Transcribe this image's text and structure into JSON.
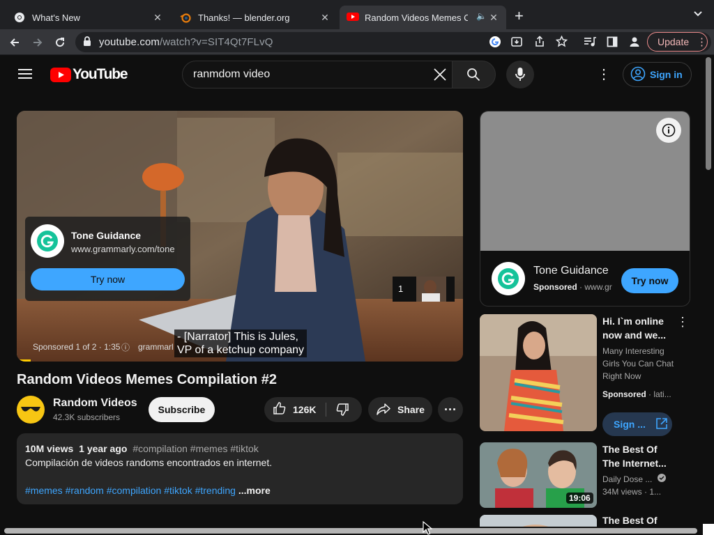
{
  "browser": {
    "tabs": [
      {
        "label": "What's New",
        "icon": "chrome-icon"
      },
      {
        "label": "Thanks! — blender.org",
        "icon": "blender-icon"
      },
      {
        "label": "Random Videos Memes Co",
        "icon": "youtube-icon",
        "active": true
      }
    ],
    "url": {
      "host": "youtube.com",
      "path": "/watch?v=SIT4Qt7FLvQ"
    },
    "update_label": "Update"
  },
  "youtube": {
    "logo_text": "YouTube",
    "search": {
      "value": "ranmdom video"
    },
    "signin_label": "Sign in",
    "ad_overlay": {
      "title": "Tone Guidance",
      "url": "www.grammarly.com/tone",
      "cta": "Try now",
      "ad_info": "Sponsored 1 of 2 · 1:35",
      "ad_domain": "grammarl",
      "queue_count": "1",
      "caption_line1": "- [Narrator] This is Jules,",
      "caption_line2": "VP of a ketchup company"
    },
    "video": {
      "title": "Random Videos Memes Compilation #2",
      "channel": "Random Videos",
      "subscribers": "42.3K subscribers",
      "subscribe_label": "Subscribe",
      "likes": "126K",
      "share_label": "Share",
      "views": "10M views",
      "age": "1 year ago",
      "desc_tags_top": "#compilation #memes #tiktok",
      "description": "Compilación de videos randoms encontrados en internet.",
      "hashtags": [
        "#memes",
        "#random",
        "#compilation",
        "#tiktok",
        "#trending"
      ],
      "more_label": "...more"
    },
    "sidebar_ad": {
      "title": "Tone Guidance",
      "sponsored": "Sponsored",
      "domain": "www.gr",
      "cta": "Try now"
    },
    "recommendations": [
      {
        "title_line1": "Hi. I`m online",
        "title_line2": "now and we...",
        "desc_lines": [
          "Many Interesting",
          "Girls You Can Chat",
          "Right Now"
        ],
        "sponsored": "Sponsored",
        "domain": "lati...",
        "cta": "Sign ..."
      },
      {
        "title_line1": "The Best Of",
        "title_line2": "The Internet...",
        "channel": "Daily Dose ...",
        "views": "34M views",
        "age": "1...",
        "duration": "19:06"
      },
      {
        "title_line1": "The Best Of"
      }
    ]
  },
  "colors": {
    "accent_blue": "#3ea6ff",
    "yt_red": "#ff0000",
    "cta_blue": "#3ea6ff",
    "grammarly_green": "#15c39a"
  }
}
